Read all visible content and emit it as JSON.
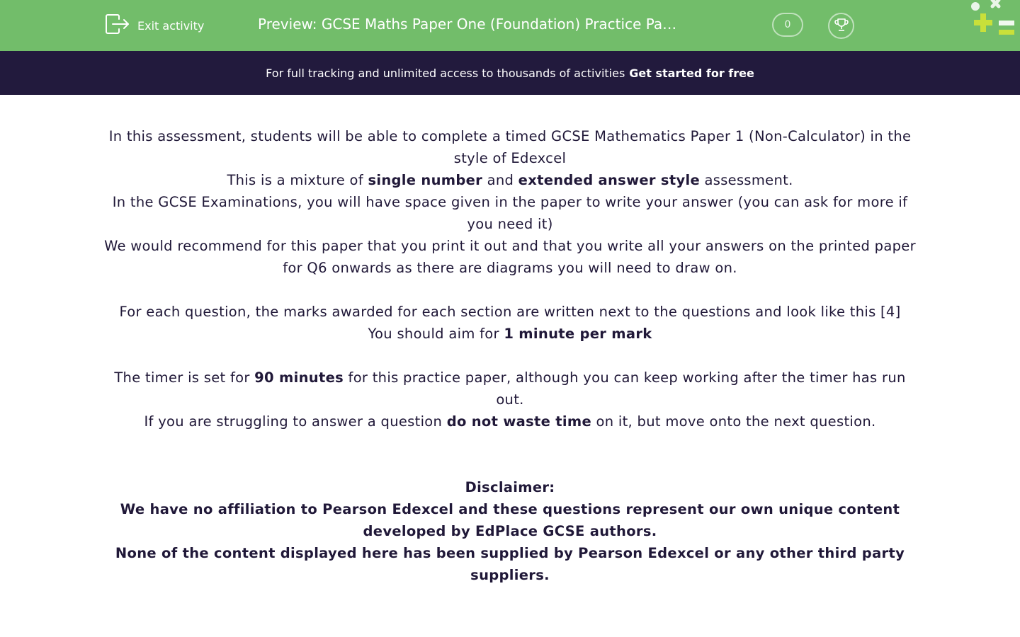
{
  "header": {
    "exit_label": "Exit activity",
    "title": "Preview: GCSE Maths Paper One (Foundation) Practice Pa…",
    "score": "0",
    "icons": [
      "exit-icon",
      "trophy-icon",
      "edplace-logo"
    ]
  },
  "banner": {
    "text": "For full tracking and unlimited access to thousands of activities",
    "cta": "Get started for free"
  },
  "intro": {
    "line1": "In this assessment, students will be able to complete a timed GCSE Mathematics Paper 1 (Non-Calculator) in the style of Edexcel",
    "line2_a": "This is a mixture of ",
    "line2_b": "single number",
    "line2_c": " and ",
    "line2_d": "extended answer style",
    "line2_e": " assessment.",
    "line3": "In the GCSE Examinations, you will have space given in the paper to write your answer (you can ask for more if you need it)",
    "line4": "We would recommend for this paper that you print it out and that you write all your answers on the printed paper for Q6 onwards as there are diagrams you will need to draw on."
  },
  "marks": {
    "line1": "For each question, the marks awarded for each section are written next to the questions and look like this [4]",
    "line2_a": "You should aim for ",
    "line2_b": "1 minute per mark"
  },
  "timer": {
    "line1_a": "The timer is set for ",
    "line1_b": "90 minutes",
    "line1_c": " for this practice paper, although you can keep working after the timer has run out.",
    "line2_a": "If you are struggling to answer a question ",
    "line2_b": "do not waste time",
    "line2_c": " on it, but move onto the next question."
  },
  "disclaimer": {
    "heading": "Disclaimer:",
    "line1": "We have no affiliation to Pearson Edexcel and these questions represent our own unique content developed by EdPlace GCSE authors.",
    "line2": "None of the content displayed here has been supplied by Pearson Edexcel or any other third party suppliers."
  },
  "colors": {
    "header_bg": "#72bd6a",
    "banner_bg": "#221a3d",
    "text": "#201838"
  }
}
